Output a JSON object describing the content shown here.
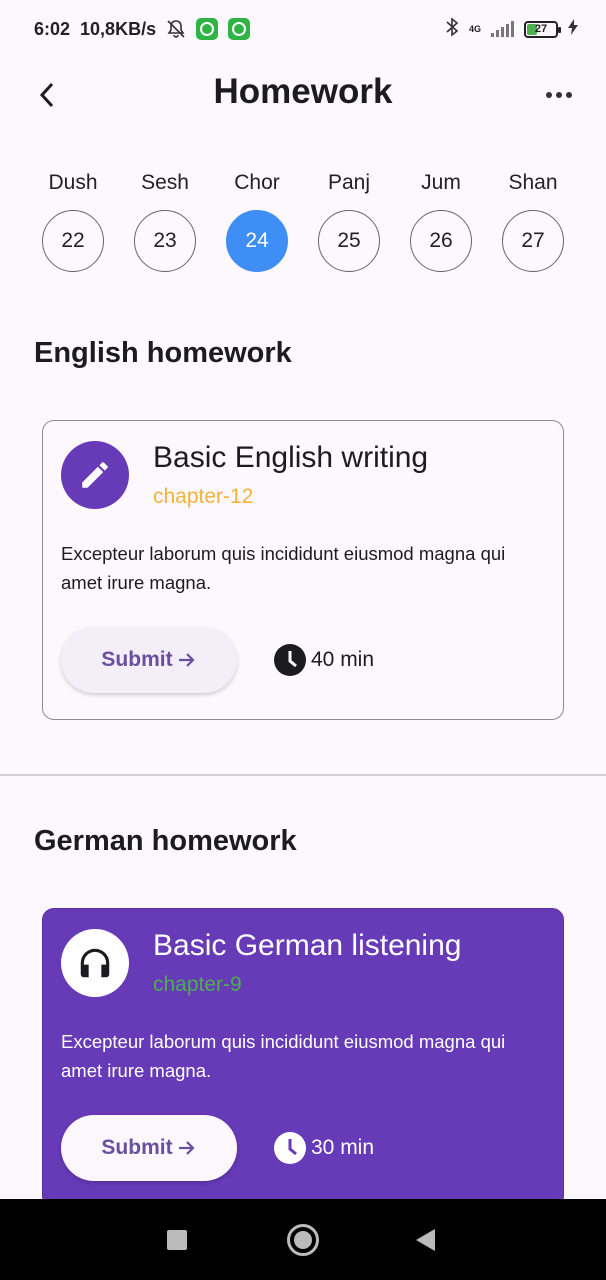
{
  "status_bar": {
    "time": "6:02",
    "speed": "10,8KB/s",
    "network": "4G",
    "battery": "27"
  },
  "header": {
    "title": "Homework"
  },
  "week": [
    {
      "name": "Dush",
      "date": "22",
      "selected": false
    },
    {
      "name": "Sesh",
      "date": "23",
      "selected": false
    },
    {
      "name": "Chor",
      "date": "24",
      "selected": true
    },
    {
      "name": "Panj",
      "date": "25",
      "selected": false
    },
    {
      "name": "Jum",
      "date": "26",
      "selected": false
    },
    {
      "name": "Shan",
      "date": "27",
      "selected": false
    }
  ],
  "sections": [
    {
      "title": "English homework",
      "card": {
        "title": "Basic English writing",
        "chapter": "chapter-12",
        "description": "Excepteur laborum quis incididunt eiusmod magna qui amet irure magna.",
        "submit_label": "Submit",
        "duration": "40 min",
        "icon": "pencil-icon"
      }
    },
    {
      "title": "German homework",
      "card": {
        "title": "Basic German listening",
        "chapter": "chapter-9",
        "description": "Excepteur laborum quis incididunt eiusmod magna qui amet irure magna.",
        "submit_label": "Submit",
        "duration": "30 min",
        "icon": "headphones-icon"
      }
    }
  ],
  "colors": {
    "accent_purple": "#673ab7",
    "selected_day_blue": "#3f8ef5",
    "chapter_orange": "#f3b23a",
    "chapter_green": "#4caf50"
  }
}
